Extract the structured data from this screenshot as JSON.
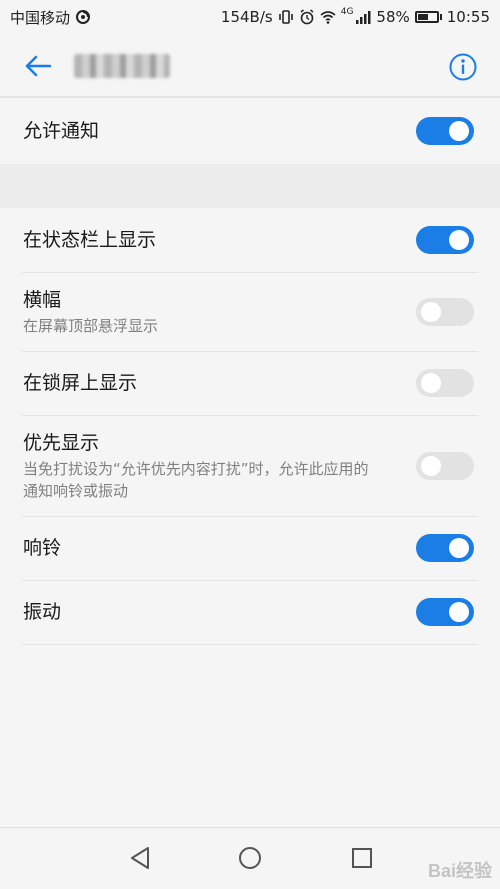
{
  "status_bar": {
    "carrier": "中国移动",
    "net_speed": "154B/s",
    "signal_label": "4G",
    "battery_percent": "58%",
    "battery_level": 0.58,
    "time": "10:55",
    "icons": [
      "carrier-activity-icon",
      "vibrate-icon",
      "alarm-icon",
      "wifi-icon",
      "cell-signal-icon",
      "battery-icon"
    ]
  },
  "app_bar": {
    "back_icon": "arrow-left-icon",
    "title_blurred": true,
    "info_icon": "info-icon",
    "accent_color": "#1b7ee6"
  },
  "settings": {
    "allow_notifications": {
      "title": "允许通知",
      "enabled": true
    },
    "items": [
      {
        "title": "在状态栏上显示",
        "subtitle": "",
        "enabled": true
      },
      {
        "title": "横幅",
        "subtitle": "在屏幕顶部悬浮显示",
        "enabled": false
      },
      {
        "title": "在锁屏上显示",
        "subtitle": "",
        "enabled": false
      },
      {
        "title": "优先显示",
        "subtitle": "当免打扰设为“允许优先内容打扰”时，允许此应用的通知响铃或振动",
        "enabled": false
      },
      {
        "title": "响铃",
        "subtitle": "",
        "enabled": true
      },
      {
        "title": "振动",
        "subtitle": "",
        "enabled": true
      }
    ]
  },
  "nav_bar": {
    "buttons": [
      "nav-back-icon",
      "nav-home-icon",
      "nav-recents-icon"
    ],
    "watermark": "Bai经验"
  },
  "colors": {
    "toggle_on": "#1b7ee6",
    "toggle_off": "#e2e2e2",
    "background": "#f5f5f5"
  }
}
